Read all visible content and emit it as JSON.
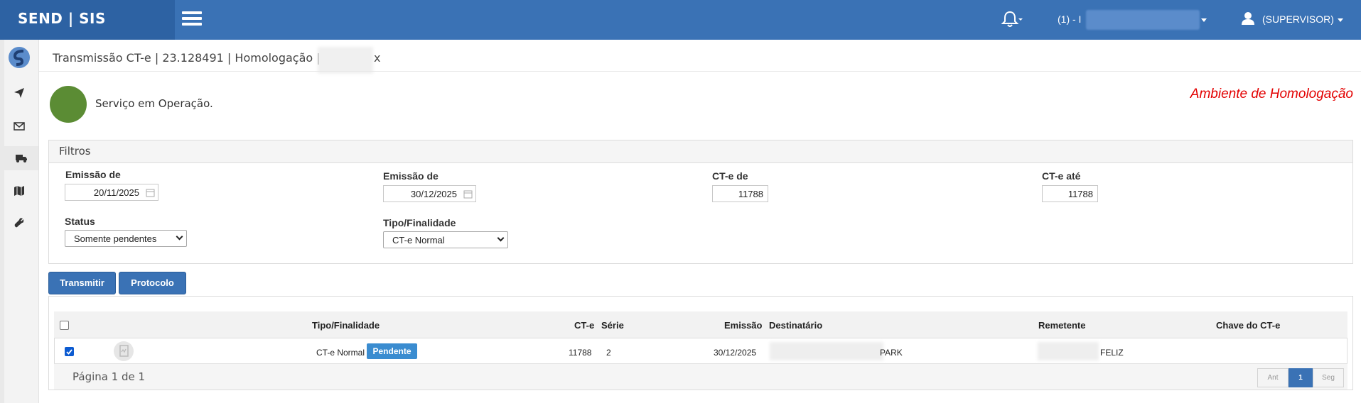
{
  "navbar": {
    "brand": "SEND | SIS",
    "company_label": "(1) - I",
    "user_label": "(SUPERVISOR)"
  },
  "sidebar": {
    "items": [
      {
        "icon": "logo-icon"
      },
      {
        "icon": "send-icon"
      },
      {
        "icon": "envelope-icon"
      },
      {
        "icon": "truck-icon"
      },
      {
        "icon": "map-icon"
      },
      {
        "icon": "wrench-icon"
      }
    ]
  },
  "breadcrumb": {
    "text": "Transmissão CT-e | 23.128491 | Homologação |",
    "tail": "x"
  },
  "status": {
    "text": "Serviço em Operação.",
    "color": "#5b8c34",
    "environment": "Ambiente de Homologação"
  },
  "filters": {
    "title": "Filtros",
    "emissao_de_label": "Emissão de",
    "emissao_de_value": "20/11/2025",
    "emissao_ate_label": "Emissão de",
    "emissao_ate_value": "30/12/2025",
    "cte_de_label": "CT-e de",
    "cte_de_value": "11788",
    "cte_ate_label": "CT-e até",
    "cte_ate_value": "11788",
    "status_label": "Status",
    "status_value": "Somente pendentes",
    "tipo_label": "Tipo/Finalidade",
    "tipo_value": "CT-e Normal"
  },
  "actions": {
    "transmitir": "Transmitir",
    "protocolo": "Protocolo"
  },
  "table": {
    "columns": [
      "Tipo/Finalidade",
      "CT-e",
      "Série",
      "Emissão",
      "Destinatário",
      "Remetente",
      "Chave do CT-e"
    ],
    "rows": [
      {
        "checked": true,
        "tipo": "CT-e Normal",
        "badge": "Pendente",
        "cte": "11788",
        "serie": "2",
        "emissao": "30/12/2025",
        "destinatario": "PARK",
        "remetente": "FELIZ",
        "chave": ""
      }
    ],
    "page_info": "Página 1 de 1",
    "pager": {
      "prev": "Ant",
      "current": "1",
      "next": "Seg"
    }
  }
}
